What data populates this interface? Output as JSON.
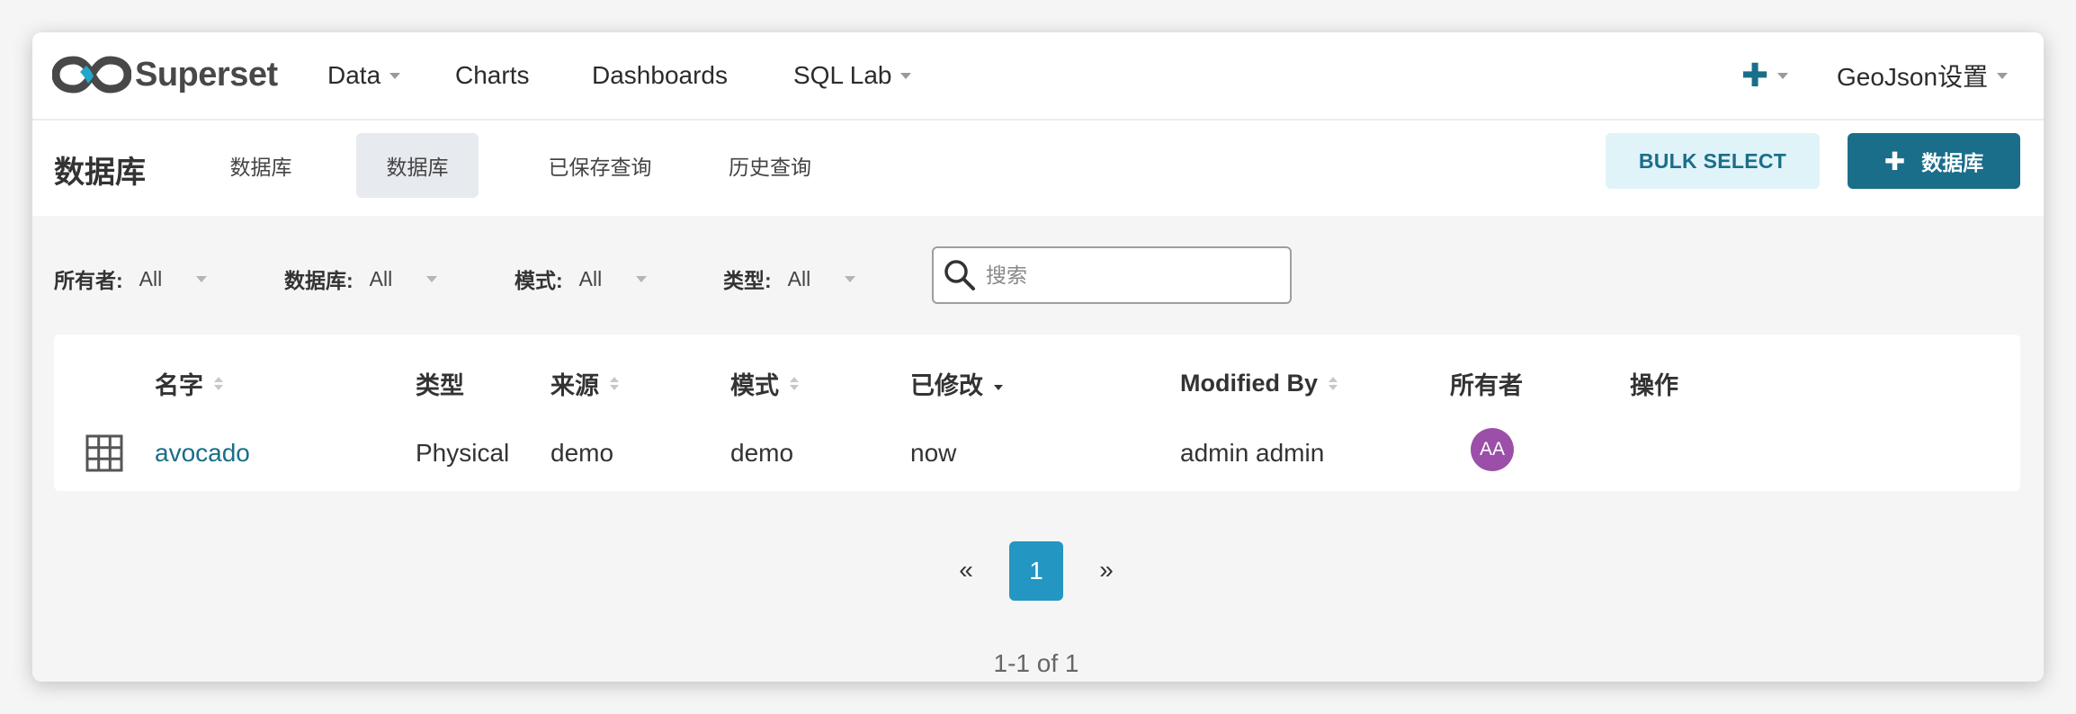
{
  "navbar": {
    "brand": "Superset",
    "menu": [
      {
        "label": "Data",
        "has_dropdown": true
      },
      {
        "label": "Charts",
        "has_dropdown": false
      },
      {
        "label": "Dashboards",
        "has_dropdown": false
      },
      {
        "label": "SQL Lab",
        "has_dropdown": true
      }
    ],
    "plus_icon": "plus-icon",
    "user_menu": "GeoJson设置"
  },
  "subheader": {
    "title": "数据库",
    "tabs": [
      {
        "label": "数据库",
        "active": false
      },
      {
        "label": "数据库",
        "active": true
      },
      {
        "label": "已保存查询",
        "active": false
      },
      {
        "label": "历史查询",
        "active": false
      }
    ],
    "bulk_select": "BULK SELECT",
    "add_button": "数据库"
  },
  "filters": [
    {
      "label": "所有者:",
      "value": "All"
    },
    {
      "label": "数据库:",
      "value": "All"
    },
    {
      "label": "模式:",
      "value": "All"
    },
    {
      "label": "类型:",
      "value": "All"
    }
  ],
  "search": {
    "placeholder": "搜索",
    "value": ""
  },
  "table": {
    "columns": [
      {
        "label": "名字",
        "sortable": true,
        "sorted": "none"
      },
      {
        "label": "类型",
        "sortable": false,
        "sorted": "none"
      },
      {
        "label": "来源",
        "sortable": true,
        "sorted": "none"
      },
      {
        "label": "模式",
        "sortable": true,
        "sorted": "none"
      },
      {
        "label": "已修改",
        "sortable": true,
        "sorted": "desc"
      },
      {
        "label": "Modified By",
        "sortable": true,
        "sorted": "none"
      },
      {
        "label": "所有者",
        "sortable": false,
        "sorted": "none"
      },
      {
        "label": "操作",
        "sortable": false,
        "sorted": "none"
      }
    ],
    "rows": [
      {
        "icon": "table-icon",
        "name": "avocado",
        "type": "Physical",
        "source": "demo",
        "schema": "demo",
        "modified": "now",
        "modified_by": "admin admin",
        "owner_initials": "AA",
        "owner_color": "#9b4fa8"
      }
    ]
  },
  "pagination": {
    "prev": "«",
    "current": "1",
    "next": "»",
    "range_text": "1-1 of 1"
  },
  "colors": {
    "primary": "#1a6e8a",
    "page_active": "#2396c2",
    "bulk_bg": "#e0f3f8",
    "avatar": "#9b4fa8"
  }
}
